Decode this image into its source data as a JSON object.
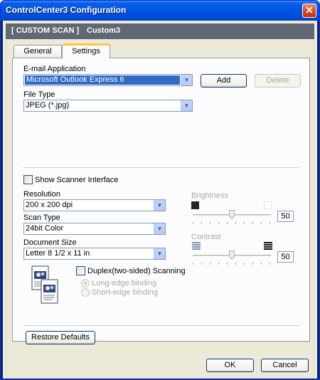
{
  "window": {
    "title": "ControlCenter3 Configuration"
  },
  "header": {
    "left": "[ CUSTOM SCAN ]",
    "right": "Custom3"
  },
  "tabs": [
    {
      "label": "General"
    },
    {
      "label": "Settings"
    }
  ],
  "email": {
    "label": "E-mail Application",
    "value": "Microsoft Outlook Express 6",
    "add": "Add",
    "delete": "Delete"
  },
  "filetype": {
    "label": "File Type",
    "value": "JPEG (*.jpg)"
  },
  "show_scanner": {
    "label": "Show Scanner Interface",
    "checked": false
  },
  "resolution": {
    "label": "Resolution",
    "value": "200 x 200 dpi"
  },
  "scantype": {
    "label": "Scan Type",
    "value": "24bit Color"
  },
  "docsize": {
    "label": "Document Size",
    "value": "Letter 8 1/2 x 11 in"
  },
  "brightness": {
    "label": "Brightness",
    "value": "50",
    "level": 0.5
  },
  "contrast": {
    "label": "Contrast",
    "value": "50",
    "level": 0.5
  },
  "duplex": {
    "label": "Duplex(two-sided) Scanning",
    "checked": false,
    "long_edge": "Long-edge binding",
    "short_edge": "Short-edge binding"
  },
  "buttons": {
    "restore": "Restore Defaults",
    "ok": "OK",
    "cancel": "Cancel"
  },
  "icons": {
    "close": "close-icon",
    "dropdown": "chevron-down-icon",
    "brightness_low": "dark-square-icon",
    "brightness_high": "light-square-icon",
    "contrast_low": "low-contrast-icon",
    "contrast_high": "high-contrast-icon",
    "duplex": "duplex-pages-icon"
  },
  "colors": {
    "title_bar": "#0054e3",
    "header_band": "#5f6873",
    "selection": "#316ac5",
    "tab_highlight": "#ffc83c"
  }
}
